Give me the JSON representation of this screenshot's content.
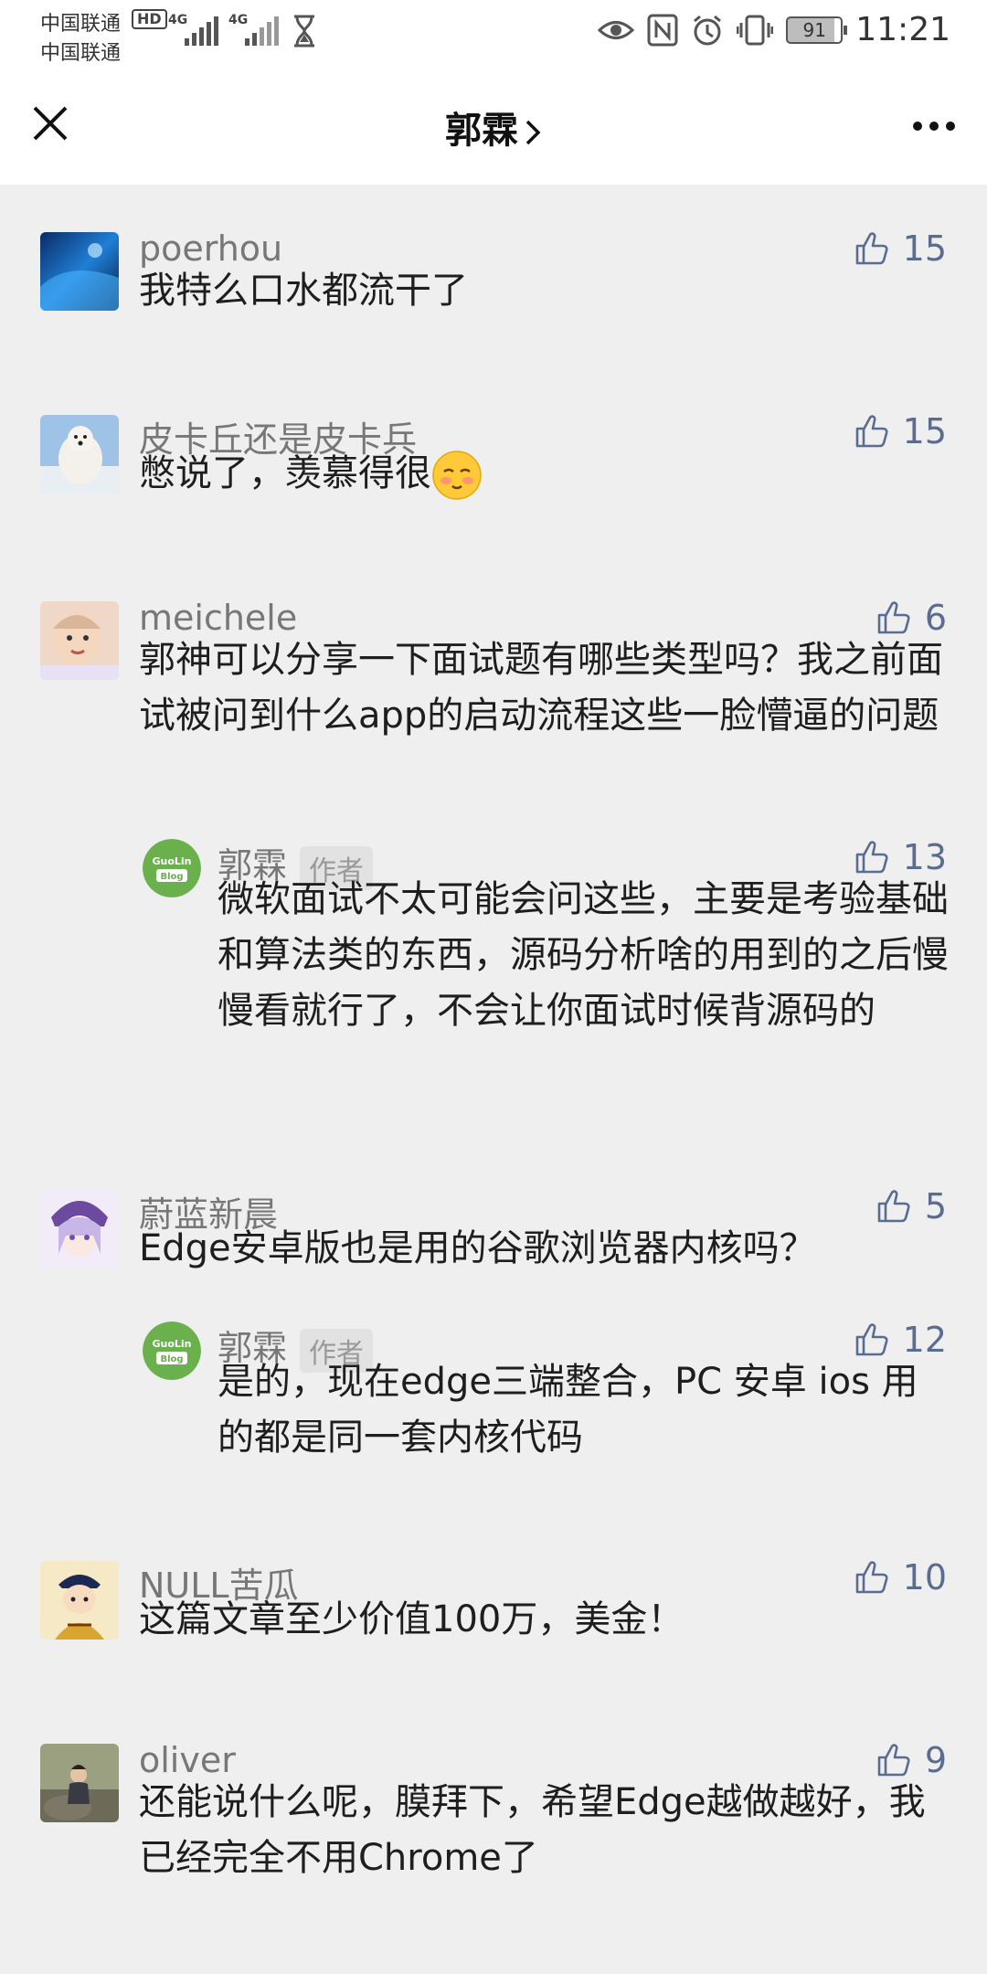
{
  "status_bar": {
    "carrier1": "中国联通",
    "carrier2": "中国联通",
    "hd": "HD",
    "net1": "4G",
    "net2": "4G",
    "battery": "91",
    "time": "11:21"
  },
  "header": {
    "title": "郭霖"
  },
  "comments": [
    {
      "name": "poerhou",
      "text": "我特么口水都流干了",
      "likes": "15"
    },
    {
      "name": "皮卡丘还是皮卡兵",
      "text": "憋说了，羡慕得很",
      "likes": "15"
    },
    {
      "name": "meichele",
      "text": "郭神可以分享一下面试题有哪些类型吗？我之前面试被问到什么app的启动流程这些一脸懵逼的问题",
      "likes": "6",
      "reply": {
        "name": "郭霖",
        "tag": "作者",
        "text": "微软面试不太可能会问这些，主要是考验基础和算法类的东西，源码分析啥的用到的之后慢慢看就行了，不会让你面试时候背源码的",
        "likes": "13",
        "badge_top": "GuoLin",
        "badge_bottom": "Blog"
      }
    },
    {
      "name": "蔚蓝新晨",
      "text": "Edge安卓版也是用的谷歌浏览器内核吗？",
      "likes": "5",
      "reply": {
        "name": "郭霖",
        "tag": "作者",
        "text": "是的，现在edge三端整合，PC 安卓 ios 用的都是同一套内核代码",
        "likes": "12",
        "badge_top": "GuoLin",
        "badge_bottom": "Blog"
      }
    },
    {
      "name": "NULL苦瓜",
      "text": "这篇文章至少价值100万，美金！",
      "likes": "10"
    },
    {
      "name": "oliver",
      "text": "还能说什么呢，膜拜下，希望Edge越做越好，我已经完全不用Chrome了",
      "likes": "9"
    }
  ],
  "colors": {
    "background": "#efefef",
    "like": "#5a6d91",
    "name": "#777777",
    "author_badge": "#6ab04c"
  }
}
